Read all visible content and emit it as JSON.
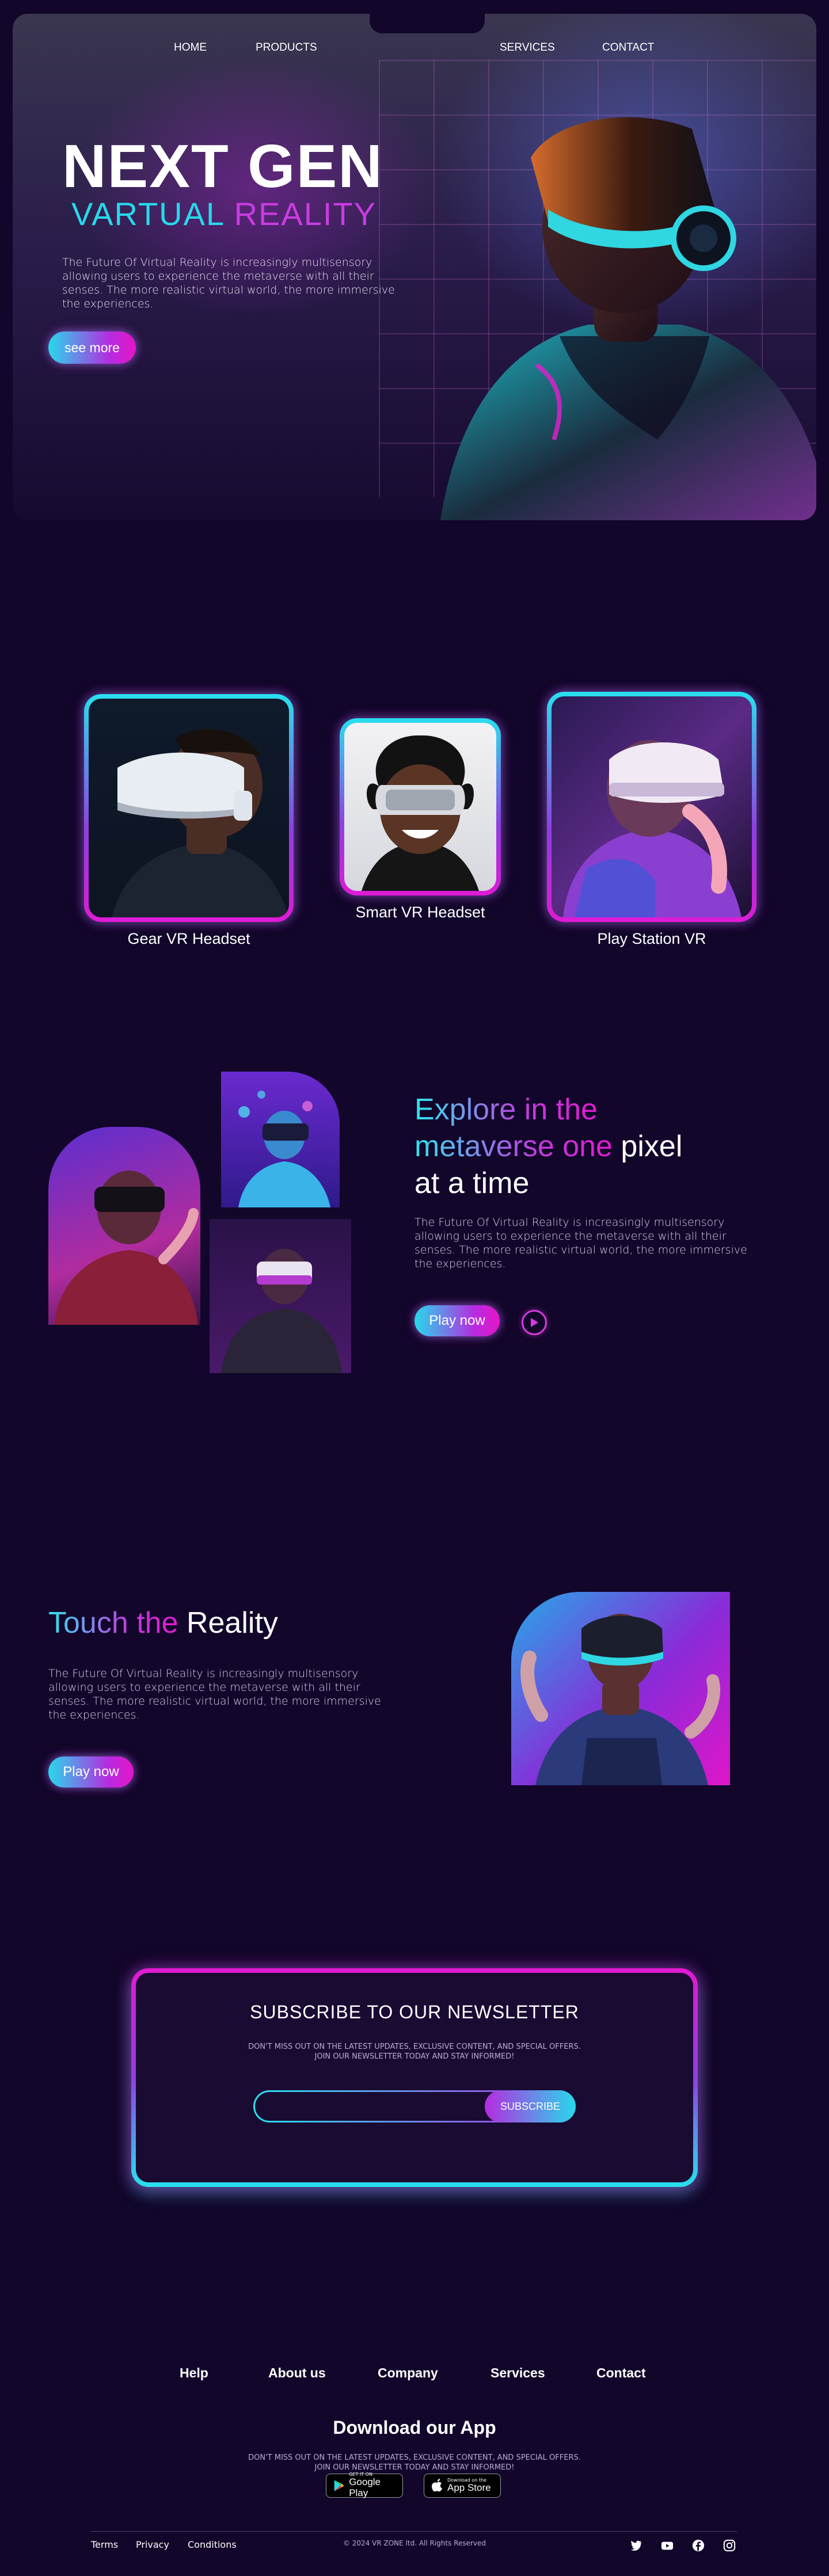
{
  "nav": {
    "items": [
      "HOME",
      "PRODUCTS",
      "SERVICES",
      "CONTACT"
    ]
  },
  "hero": {
    "title": "NEXT GEN",
    "subtitle_a": "VARTUAL",
    "subtitle_b": "REALITY",
    "description": "The Future Of Virtual Reality is increasingly multisensory allowing users to experience the metaverse with all their senses. The more realistic virtual world, the more immersive the experiences.",
    "button": "see more"
  },
  "products": [
    {
      "label": "Gear VR Headset"
    },
    {
      "label": "Smart VR Headset"
    },
    {
      "label": "Play Station VR"
    }
  ],
  "explore": {
    "title_a": "Explore in the",
    "title_b": "metaverse one",
    "title_c": "pixel",
    "title_d": "at a time",
    "description": "The Future Of Virtual Reality is increasingly multisensory allowing users to experience the metaverse with all their senses. The more realistic virtual world, the more immersive the experiences.",
    "button": "Play now"
  },
  "touch": {
    "title_a": "Touch the",
    "title_b": "Reality",
    "description": "The Future Of Virtual Reality is increasingly multisensory allowing users to experience the metaverse with all their senses. The more realistic virtual world, the more immersive the experiences.",
    "button": "Play now"
  },
  "newsletter": {
    "title": "SUBSCRIBE TO OUR NEWSLETTER",
    "description": "DON'T MISS OUT ON THE LATEST UPDATES, EXCLUSIVE CONTENT, AND SPECIAL OFFERS. JOIN OUR NEWSLETTER TODAY AND STAY INFORMED!",
    "input_value": "",
    "button": "SUBSCRIBE"
  },
  "footer": {
    "links": [
      "Help",
      "About us",
      "Company",
      "Services",
      "Contact"
    ],
    "app_title": "Download our App",
    "app_desc": "DON'T MISS OUT ON THE LATEST UPDATES, EXCLUSIVE CONTENT, AND SPECIAL OFFERS. JOIN OUR NEWSLETTER TODAY AND STAY INFORMED!",
    "google_small": "GET IT ON",
    "google_big": "Google Play",
    "apple_small": "Download on the",
    "apple_big": "App Store",
    "bottom_links": [
      "Terms",
      "Privacy",
      "Conditions"
    ],
    "copyright": "© 2024 VR ZONE ltd. All Rights Reserved"
  },
  "icons": {
    "play": "play-icon",
    "social": [
      "twitter-icon",
      "youtube-icon",
      "facebook-icon",
      "instagram-icon"
    ],
    "stores": [
      "google-play-icon",
      "apple-icon"
    ]
  },
  "colors": {
    "background": "#12062a",
    "accent_cyan": "#27d9ec",
    "accent_magenta": "#e615c8",
    "accent_purple": "#b52ce0"
  }
}
